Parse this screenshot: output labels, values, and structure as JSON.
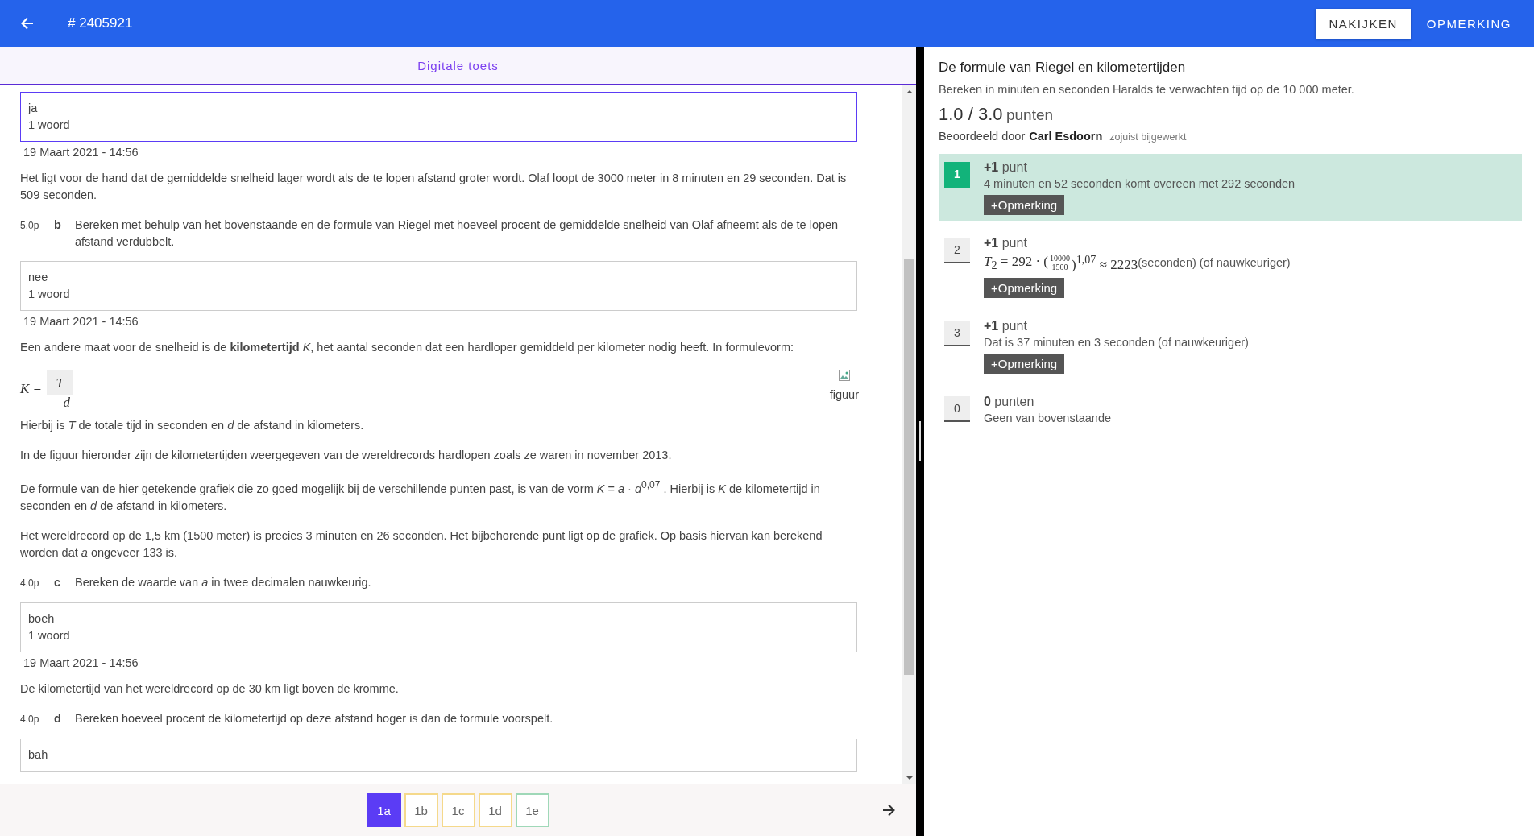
{
  "topbar": {
    "title": "# 2405921",
    "buttons": [
      {
        "label": "NAKIJKEN",
        "kind": "raised"
      },
      {
        "label": "OPMERKING",
        "kind": "flat"
      }
    ]
  },
  "left": {
    "tab": "Digitale toets",
    "blocks": [
      {
        "kind": "answer",
        "lines": [
          "ja",
          "1 woord"
        ],
        "selected": true
      },
      {
        "kind": "date",
        "text": "19 Maart 2021 - 14:56"
      },
      {
        "kind": "paragraph",
        "text": "Het ligt voor de hand dat de gemiddelde snelheid lager wordt als de te lopen afstand groter wordt. Olaf loopt de 3000 meter in 8 minuten en 29 seconden. Dat is 509 seconden."
      },
      {
        "kind": "question",
        "points": "5.0p",
        "letter": "b",
        "text": "Bereken met behulp van het bovenstaande en de formule van Riegel met hoeveel procent de gemiddelde snelheid van Olaf afneemt als de te lopen afstand verdubbelt."
      },
      {
        "kind": "answer",
        "lines": [
          "nee",
          "1 woord"
        ],
        "selected": false
      },
      {
        "kind": "date",
        "text": "19 Maart 2021 - 14:56"
      },
      {
        "kind": "paragraph",
        "text": "Een andere maat voor de snelheid is de **kilometertijd** *K*, het aantal seconden dat een hardloper gemiddeld per kilometer nodig heeft. In formulevorm:"
      },
      {
        "kind": "fraction",
        "lhs": "K =",
        "num": "T",
        "den": "d",
        "figure": "figuur"
      },
      {
        "kind": "paragraph",
        "text": "Hierbij is *T* de totale tijd in seconden en *d* de afstand in kilometers."
      },
      {
        "kind": "paragraph",
        "text": "In de figuur hieronder zijn de kilometertijden weergegeven van de wereldrecords hardlopen zoals ze waren in november 2013."
      },
      {
        "kind": "paragraph",
        "text": "De formule van de hier getekende grafiek die zo goed mogelijk bij de verschillende punten past, is van de vorm *K* = *a* · *d*$^{0,07}$ . Hierbij is *K* de kilometertijd in seconden en *d* de afstand in kilometers."
      },
      {
        "kind": "paragraph",
        "text": "Het wereldrecord op de 1,5 km (1500 meter) is precies 3 minuten en 26 seconden. Het bijbehorende punt ligt op de grafiek. Op basis hiervan kan berekend worden dat *a* ongeveer 133 is."
      },
      {
        "kind": "question",
        "points": "4.0p",
        "letter": "c",
        "text": "Bereken de waarde van *a* in twee decimalen nauwkeurig."
      },
      {
        "kind": "answer",
        "lines": [
          "boeh",
          "1 woord"
        ],
        "selected": false
      },
      {
        "kind": "date",
        "text": "19 Maart 2021 - 14:56"
      },
      {
        "kind": "paragraph",
        "text": "De kilometertijd van het wereldrecord op de 30 km ligt boven de kromme."
      },
      {
        "kind": "question",
        "points": "4.0p",
        "letter": "d",
        "text": "Bereken hoeveel procent de kilometertijd op deze afstand hoger is dan de formule voorspelt."
      },
      {
        "kind": "answer",
        "lines": [
          "bah"
        ],
        "selected": false
      }
    ],
    "nav": [
      {
        "label": "1a",
        "selected": true,
        "color": "#5b3cf5"
      },
      {
        "label": "1b",
        "selected": false,
        "color": "#f5d98b"
      },
      {
        "label": "1c",
        "selected": false,
        "color": "#f5d98b"
      },
      {
        "label": "1d",
        "selected": false,
        "color": "#f5d98b"
      },
      {
        "label": "1e",
        "selected": false,
        "color": "#9fd8b8"
      }
    ]
  },
  "right": {
    "title": "De formule van Riegel en kilometertijden",
    "question": "Bereken in minuten en seconden Haralds te verwachten tijd op de 10 000 meter.",
    "score": "1.0 / 3.0",
    "score_unit": "punten",
    "graded_by_label": "Beoordeeld door",
    "grader": "Carl Esdoorn",
    "updated": "zojuist bijgewerkt",
    "rubric": [
      {
        "number": "1",
        "points": "+1",
        "unit": "punt",
        "selected": true,
        "kind": "text",
        "description": "4 minuten en 52 seconden komt overeen met 292 seconden",
        "button": "+Opmerking"
      },
      {
        "number": "2",
        "points": "+1",
        "unit": "punt",
        "selected": false,
        "kind": "formula",
        "lhs": "*T*$_{2}$ = 292 · (",
        "num": "10000",
        "den": "1500",
        "rhs": ")$^{1,07}$ ≈ 2223",
        "description": "(seconden) (of nauwkeuriger)",
        "button": "+Opmerking"
      },
      {
        "number": "3",
        "points": "+1",
        "unit": "punt",
        "selected": false,
        "kind": "text",
        "description": "Dat is 37 minuten en 3 seconden (of nauwkeuriger)",
        "button": "+Opmerking"
      },
      {
        "number": "0",
        "points": "0",
        "unit": "punten",
        "selected": false,
        "kind": "text",
        "description": "Geen van bovenstaande"
      }
    ]
  }
}
